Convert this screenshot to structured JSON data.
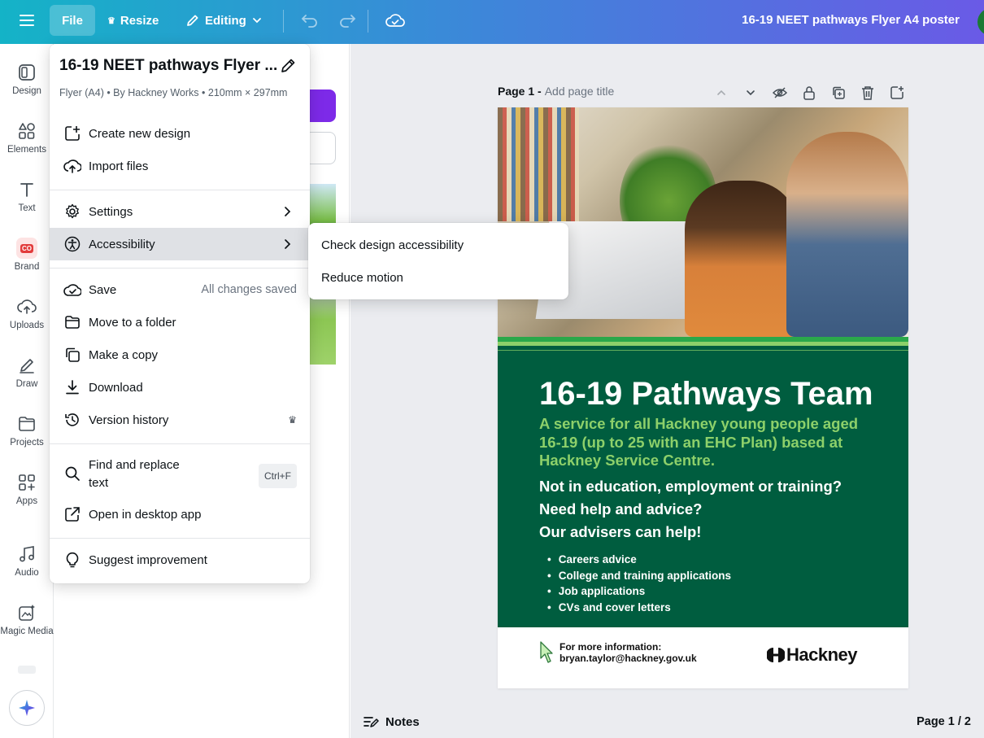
{
  "topbar": {
    "file_label": "File",
    "resize_label": "Resize",
    "editing_label": "Editing",
    "doc_title": "16-19 NEET pathways Flyer A4 poster"
  },
  "rail": {
    "items": [
      {
        "label": "Design",
        "icon": "design-icon"
      },
      {
        "label": "Elements",
        "icon": "elements-icon"
      },
      {
        "label": "Text",
        "icon": "text-icon"
      },
      {
        "label": "Brand",
        "icon": "brand-icon"
      },
      {
        "label": "Uploads",
        "icon": "upload-icon"
      },
      {
        "label": "Draw",
        "icon": "draw-icon"
      },
      {
        "label": "Projects",
        "icon": "folder-icon"
      },
      {
        "label": "Apps",
        "icon": "apps-icon"
      },
      {
        "label": "Audio",
        "icon": "music-icon"
      },
      {
        "label": "Magic Media",
        "icon": "magic-media-icon"
      }
    ],
    "brand_badge": "CO"
  },
  "file_menu": {
    "title": "16-19 NEET pathways Flyer ...",
    "meta": "Flyer (A4) • By Hackney Works • 210mm × 297mm",
    "create": "Create new design",
    "import": "Import files",
    "settings": "Settings",
    "accessibility": "Accessibility",
    "save": "Save",
    "save_status": "All changes saved",
    "move": "Move to a folder",
    "copy": "Make a copy",
    "download": "Download",
    "version": "Version history",
    "find_line1": "Find and replace",
    "find_line2": "text",
    "find_shortcut": "Ctrl+F",
    "desktop": "Open in desktop app",
    "suggest": "Suggest improvement"
  },
  "accessibility_submenu": {
    "check": "Check design accessibility",
    "reduce": "Reduce motion"
  },
  "canvas": {
    "page_label": "Page 1 -",
    "page_title_placeholder": "Add page title",
    "notes_label": "Notes",
    "page_count": "Page 1 / 2"
  },
  "poster": {
    "title": "16-19 Pathways Team",
    "subtitle": "A service for all Hackney young people aged 16-19 (up to 25 with an EHC Plan) based at Hackney Service Centre.",
    "q1": "Not in education, employment or training?",
    "q2": "Need help and advice?",
    "q3": "Our advisers can help!",
    "list": [
      "Careers advice",
      "College and training applications",
      "Job applications",
      "CVs and cover letters"
    ],
    "info_line1": "For more information:",
    "info_line2": "bryan.taylor@hackney.gov.uk",
    "logo_text": "Hackney"
  },
  "colors": {
    "accent_purple": "#7d2ae8",
    "poster_green": "#005d3f",
    "poster_light_green": "#8dd06a"
  }
}
